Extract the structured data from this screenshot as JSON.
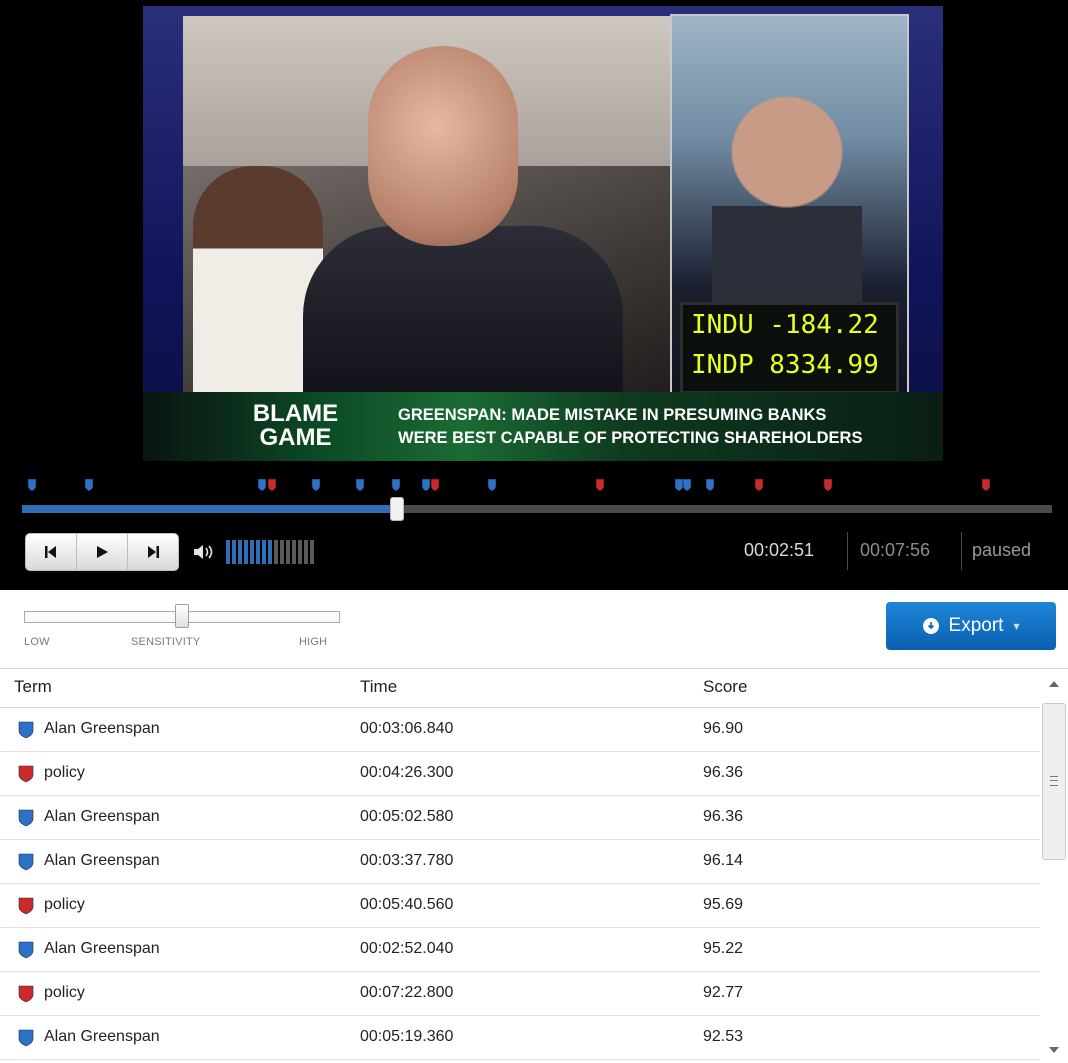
{
  "video": {
    "blame_label_line1": "BLAME",
    "blame_label_line2": "GAME",
    "headline_line1": "GREENSPAN: MADE MISTAKE IN PRESUMING BANKS",
    "headline_line2": "WERE BEST CAPABLE OF PROTECTING SHAREHOLDERS",
    "ticker_line1": "INDU -184.22",
    "ticker_line2": "INDP 8334.99"
  },
  "player": {
    "current_time": "00:02:51",
    "total_time": "00:07:56",
    "state": "paused",
    "progress_fraction": 0.364,
    "volume_level": 0.5,
    "transport": {
      "prev_icon": "skip-back-icon",
      "play_icon": "play-icon",
      "next_icon": "skip-forward-icon"
    },
    "markers": [
      {
        "color": "blue",
        "pos": 0.01
      },
      {
        "color": "blue",
        "pos": 0.065
      },
      {
        "color": "blue",
        "pos": 0.233
      },
      {
        "color": "red",
        "pos": 0.243
      },
      {
        "color": "blue",
        "pos": 0.285
      },
      {
        "color": "blue",
        "pos": 0.328
      },
      {
        "color": "blue",
        "pos": 0.363
      },
      {
        "color": "blue",
        "pos": 0.392
      },
      {
        "color": "red",
        "pos": 0.401
      },
      {
        "color": "blue",
        "pos": 0.456
      },
      {
        "color": "red",
        "pos": 0.561
      },
      {
        "color": "blue",
        "pos": 0.638
      },
      {
        "color": "blue",
        "pos": 0.646
      },
      {
        "color": "blue",
        "pos": 0.668
      },
      {
        "color": "red",
        "pos": 0.716
      },
      {
        "color": "red",
        "pos": 0.783
      },
      {
        "color": "red",
        "pos": 0.936
      }
    ],
    "colors": {
      "blue_marker": "#2d72c9",
      "red_marker": "#cc2a2a",
      "accent": "#2f6db6"
    }
  },
  "sensitivity": {
    "low_label": "LOW",
    "mid_label": "SENSITIVITY",
    "high_label": "HIGH",
    "value_fraction": 0.5
  },
  "export": {
    "label": "Export",
    "icon": "download-circle-icon"
  },
  "table": {
    "headers": {
      "term": "Term",
      "time": "Time",
      "score": "Score"
    },
    "rows": [
      {
        "term": "Alan Greenspan",
        "time": "00:03:06.840",
        "score": "96.90",
        "color": "blue"
      },
      {
        "term": "policy",
        "time": "00:04:26.300",
        "score": "96.36",
        "color": "red"
      },
      {
        "term": "Alan Greenspan",
        "time": "00:05:02.580",
        "score": "96.36",
        "color": "blue"
      },
      {
        "term": "Alan Greenspan",
        "time": "00:03:37.780",
        "score": "96.14",
        "color": "blue"
      },
      {
        "term": "policy",
        "time": "00:05:40.560",
        "score": "95.69",
        "color": "red"
      },
      {
        "term": "Alan Greenspan",
        "time": "00:02:52.040",
        "score": "95.22",
        "color": "blue"
      },
      {
        "term": "policy",
        "time": "00:07:22.800",
        "score": "92.77",
        "color": "red"
      },
      {
        "term": "Alan Greenspan",
        "time": "00:05:19.360",
        "score": "92.53",
        "color": "blue"
      }
    ]
  }
}
